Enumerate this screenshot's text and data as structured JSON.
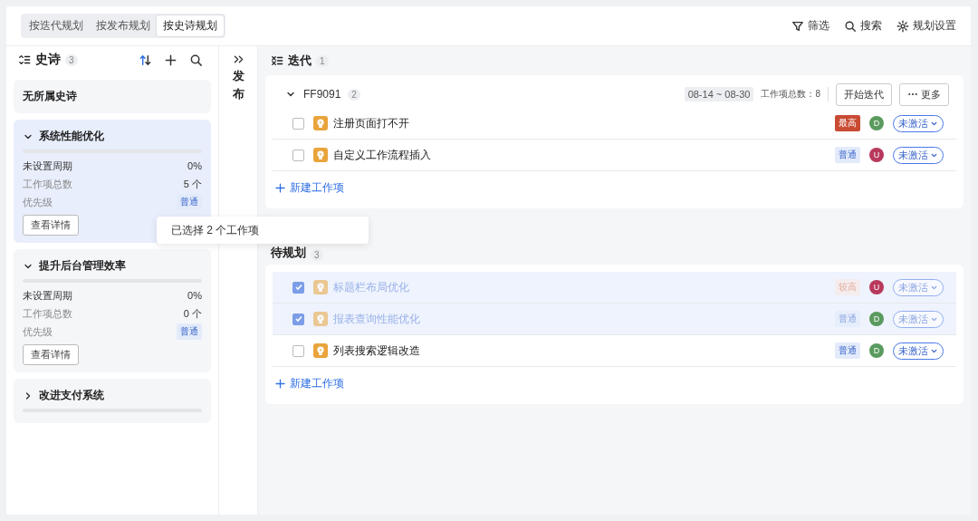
{
  "view_tabs": [
    {
      "label": "按迭代规划",
      "selected": false
    },
    {
      "label": "按发布规划",
      "selected": false
    },
    {
      "label": "按史诗规划",
      "selected": true
    }
  ],
  "toolbar": [
    "筛选",
    "搜索",
    "规划设置"
  ],
  "epic_panel": {
    "title": "史诗",
    "count": "3",
    "no_epic": "无所属史诗",
    "epics": [
      {
        "title": "系统性能优化",
        "expanded": true,
        "selected": true,
        "level": 0,
        "period": "未设置周期",
        "percent": "0%",
        "total_label": "工作项总数",
        "total": "5 个",
        "priority_label": "优先级",
        "priority": "普通",
        "details": "查看详情"
      },
      {
        "title": "提升后台管理效率",
        "expanded": true,
        "selected": false,
        "level": 0,
        "period": "未设置周期",
        "percent": "0%",
        "total_label": "工作项总数",
        "total": "0 个",
        "priority_label": "优先级",
        "priority": "普通",
        "details": "查看详情"
      },
      {
        "title": "改进支付系统",
        "expanded": false,
        "selected": false,
        "level": 0
      }
    ]
  },
  "release_column": {
    "title": "发布"
  },
  "iteration_section": {
    "title": "迭代",
    "count": "1",
    "iteration": {
      "name": "FF9091",
      "count": "2",
      "expanded": true,
      "dates": "08-14 ~ 08-30",
      "total": "工作项总数：8",
      "start": "开始迭代",
      "more": "更多",
      "items": [
        {
          "title": "注册页面打不开",
          "checked": false,
          "selected": false,
          "priority": {
            "text": "最高",
            "kind": "highest"
          },
          "assignee": {
            "initial": "D",
            "color": "#5a9a5e"
          },
          "status": "未激活"
        },
        {
          "title": "自定义工作流程插入",
          "checked": false,
          "selected": false,
          "priority": {
            "text": "普通",
            "kind": "normal"
          },
          "assignee": {
            "initial": "U",
            "color": "#b8395c"
          },
          "status": "未激活"
        }
      ],
      "new_item": "新建工作项"
    }
  },
  "backlog_section": {
    "title": "待规划",
    "count": "3",
    "items": [
      {
        "title": "标题栏布局优化",
        "checked": true,
        "selected": true,
        "priority": {
          "text": "较高",
          "kind": "high"
        },
        "assignee": {
          "initial": "U",
          "color": "#b8395c"
        },
        "status": "未激活"
      },
      {
        "title": "报表查询性能优化",
        "checked": true,
        "selected": true,
        "priority": {
          "text": "普通",
          "kind": "normal"
        },
        "assignee": {
          "initial": "D",
          "color": "#5a9a5e"
        },
        "status": "未激活"
      },
      {
        "title": "列表搜索逻辑改造",
        "checked": false,
        "selected": false,
        "priority": {
          "text": "普通",
          "kind": "normal"
        },
        "assignee": {
          "initial": "D",
          "color": "#5a9a5e"
        },
        "status": "未激活"
      }
    ],
    "new_item": "新建工作项"
  },
  "drag_hint": "已选择 2 个工作项"
}
